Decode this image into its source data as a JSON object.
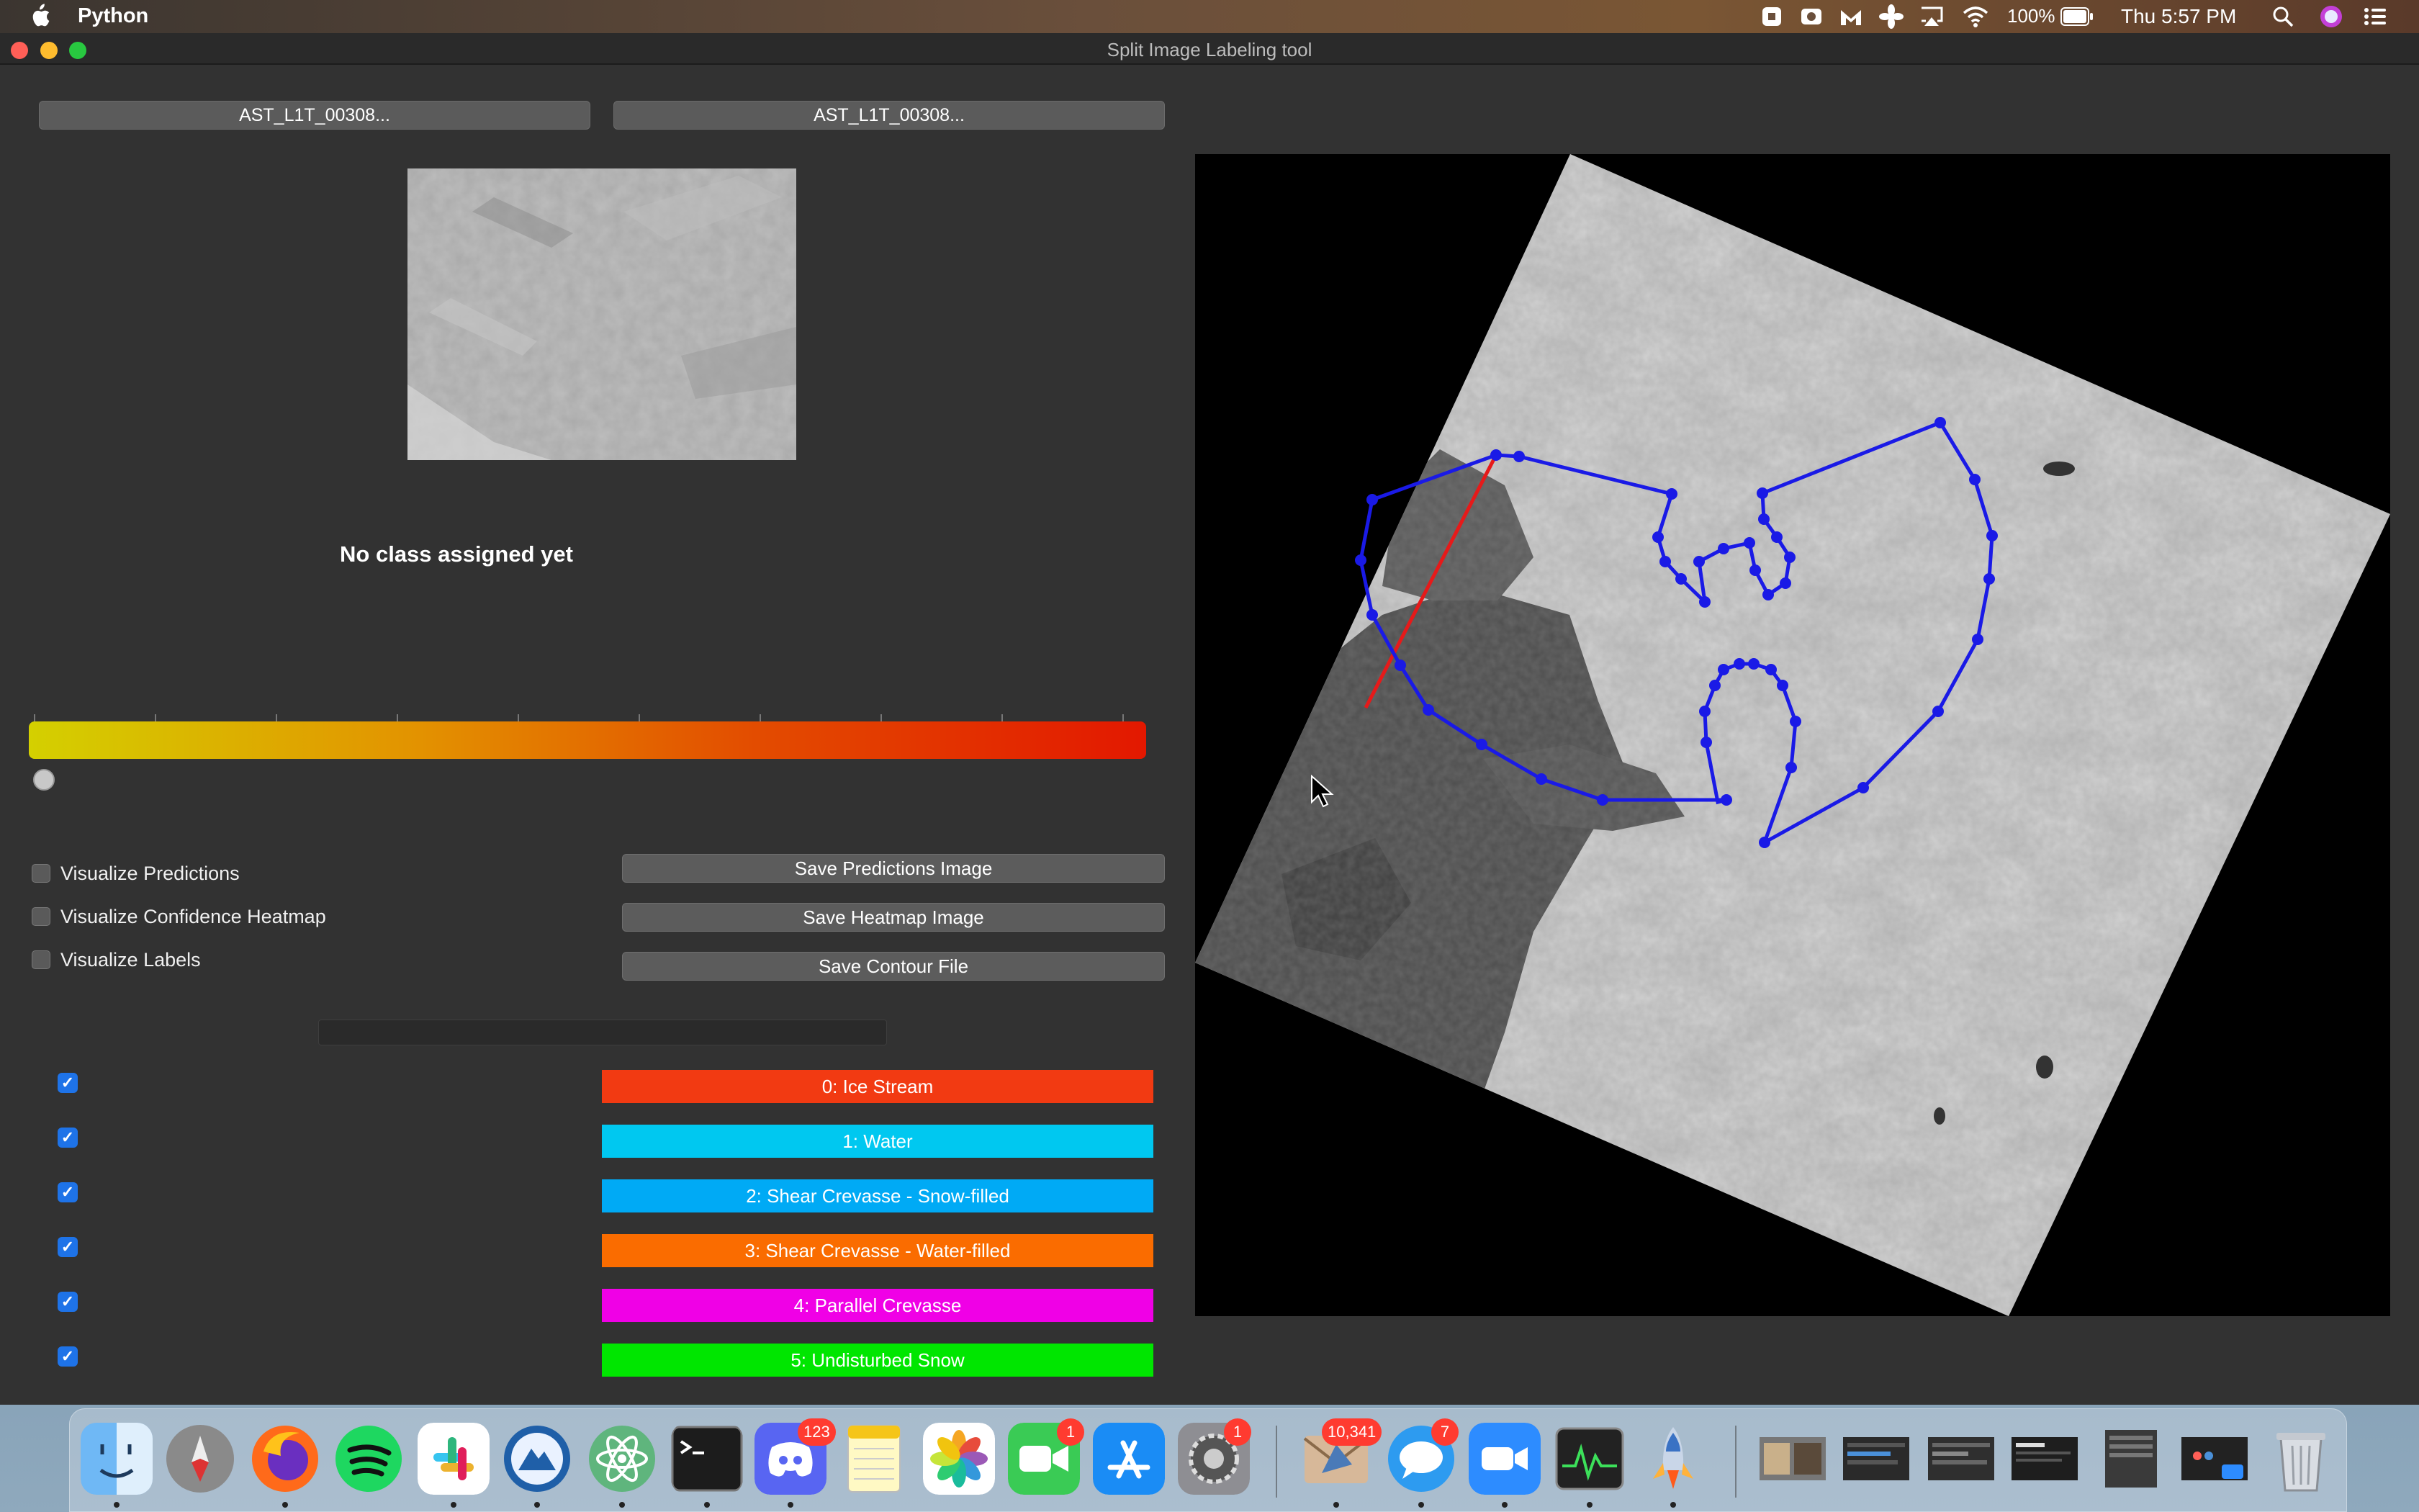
{
  "menubar": {
    "app_name": "Python",
    "battery_pct": "100%",
    "clock": "Thu 5:57 PM"
  },
  "window": {
    "title": "Split Image Labeling tool"
  },
  "files": {
    "left": "AST_L1T_00308...",
    "right": "AST_L1T_00308..."
  },
  "class_status": "No class assigned yet",
  "options": {
    "visualize_predictions": "Visualize Predictions",
    "visualize_heatmap": "Visualize Confidence Heatmap",
    "visualize_labels": "Visualize Labels",
    "save_predictions": "Save Predictions Image",
    "save_heatmap": "Save Heatmap Image",
    "save_contour": "Save Contour File"
  },
  "slider": {
    "value_fraction": 0.0,
    "colors": [
      "#d4d000",
      "#e31800"
    ]
  },
  "classes": [
    {
      "label": "0: Ice Stream",
      "color": "#f23a12",
      "checked": true
    },
    {
      "label": "1: Water",
      "color": "#00c8f0",
      "checked": true
    },
    {
      "label": "2: Shear Crevasse - Snow-filled",
      "color": "#00aaf5",
      "checked": true
    },
    {
      "label": "3: Shear Crevasse - Water-filled",
      "color": "#fa6c00",
      "checked": true
    },
    {
      "label": "4: Parallel Crevasse",
      "color": "#f000e6",
      "checked": true
    },
    {
      "label": "5: Undisturbed Snow",
      "color": "#00e600",
      "checked": true
    }
  ],
  "annotation": {
    "contour_color": "#1a1ae6",
    "line_color": "#e61a1a"
  },
  "dock": {
    "apps": [
      "finder-icon",
      "launchpad-icon",
      "firefox-icon",
      "spotify-icon",
      "slack-icon",
      "vpn-icon",
      "atom-icon",
      "terminal-icon",
      "discord-icon",
      "notes-icon",
      "photos-icon",
      "facetime-icon",
      "app-store-icon",
      "system-preferences-icon",
      "mail-icon",
      "messages-icon",
      "zoom-icon",
      "activity-monitor-icon",
      "rocket-icon"
    ],
    "badges": {
      "discord": "123",
      "facetime": "1",
      "system_preferences": "1",
      "mail": "10,341",
      "messages": "7"
    }
  }
}
